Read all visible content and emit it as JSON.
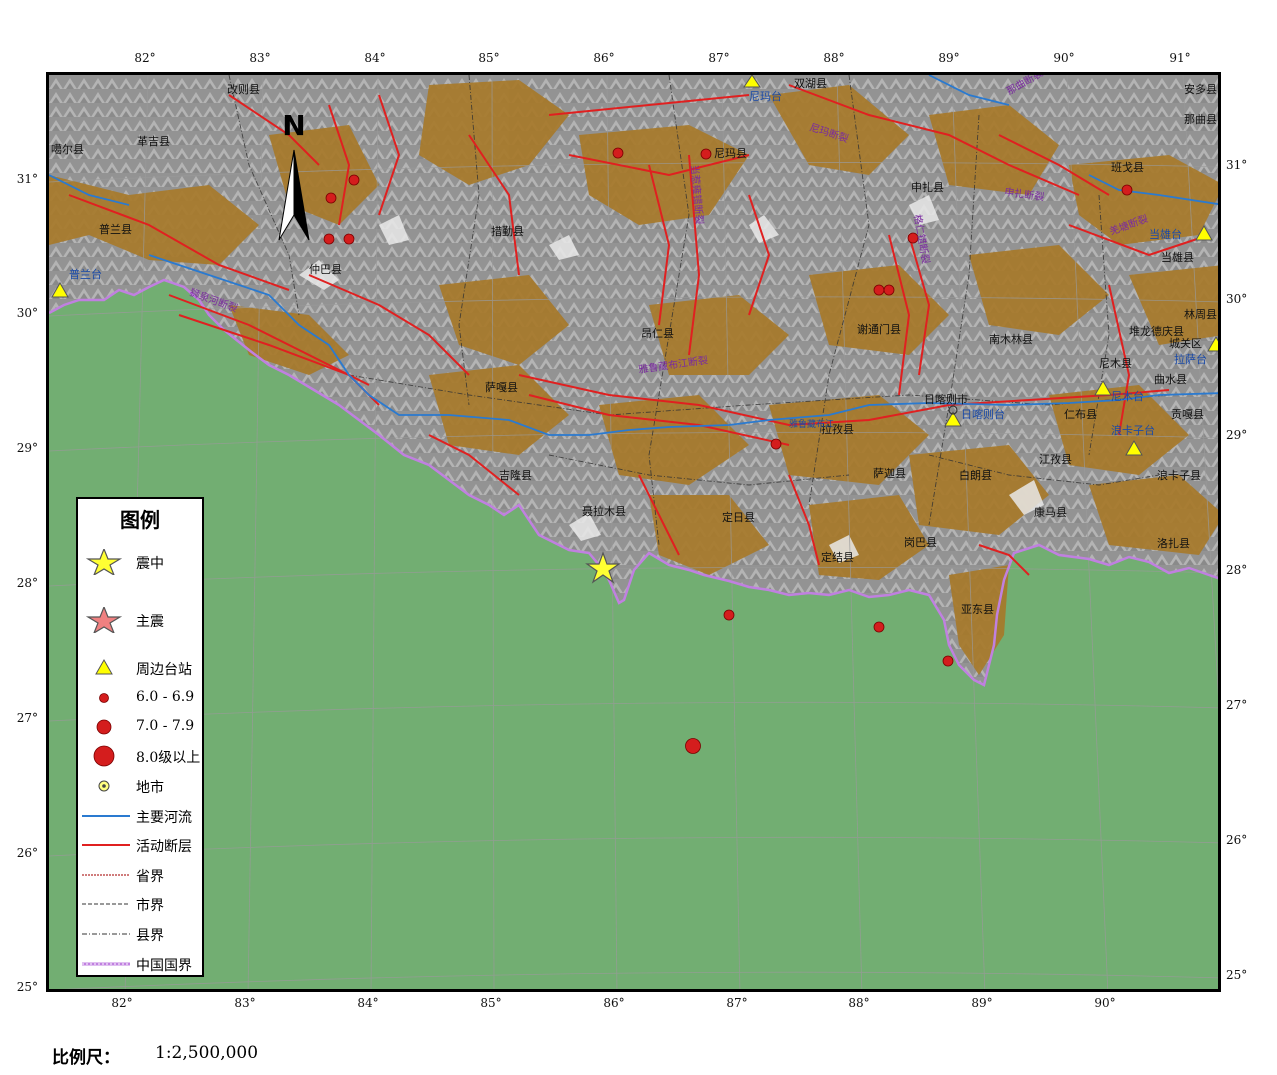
{
  "map": {
    "lon_ticks": [
      "82°",
      "83°",
      "84°",
      "85°",
      "86°",
      "87°",
      "88°",
      "89°",
      "90°",
      "91°"
    ],
    "lat_ticks": [
      "31°",
      "30°",
      "29°",
      "28°",
      "27°",
      "26°",
      "25°"
    ],
    "north_arrow": "N",
    "colors": {
      "ocean": "#72ae72",
      "plateau": "#a87a2a",
      "mountain": "#8e8e8e",
      "snow": "#e8e8e8",
      "fault": "#e02020",
      "river": "#2a7ad0",
      "border": "#c080e0",
      "quake": "#d41d1d",
      "station": "#ffff00",
      "epicenter": "#ffff33",
      "mainshock": "#f08080"
    }
  },
  "places": [
    "改则县",
    "革吉县",
    "噶尔县",
    "普兰县",
    "普兰台",
    "仲巴县",
    "措勤县",
    "尼玛县",
    "双湖县",
    "尼玛台",
    "申扎县",
    "班戈县",
    "安多县",
    "那曲县",
    "当雄台",
    "当雄县",
    "林周县",
    "堆龙德庆县",
    "城关区",
    "拉萨台",
    "曲水县",
    "贡嘎县",
    "尼木县",
    "尼木台",
    "南木林县",
    "谢通门县",
    "昂仁县",
    "萨嘎县",
    "吉隆县",
    "聂拉木县",
    "定日县",
    "拉孜县",
    "萨迦县",
    "日喀则市",
    "日喀则台",
    "仁布县",
    "江孜县",
    "白朗县",
    "浪卡子台",
    "浪卡子县",
    "康马县",
    "岗巴县",
    "定结县",
    "亚东县",
    "洛扎县"
  ],
  "faults": [
    "雅鲁藏布江断裂",
    "狮泉河断裂",
    "尼玛断裂",
    "当惹雍错断裂",
    "格仁错断裂",
    "那曲断裂",
    "羌塘断裂",
    "申扎断裂"
  ],
  "river_labels": [
    "雅鲁藏布江"
  ],
  "legend": {
    "title": "图例",
    "items": [
      {
        "label": "震中",
        "icon": "star-yellow-icon"
      },
      {
        "label": "主震",
        "icon": "star-pink-icon"
      },
      {
        "label": "周边台站",
        "icon": "triangle-yellow-icon"
      },
      {
        "label": "6.0 - 6.9",
        "icon": "dot-small-icon"
      },
      {
        "label": "7.0 - 7.9",
        "icon": "dot-medium-icon"
      },
      {
        "label": "8.0级以上",
        "icon": "dot-large-icon"
      },
      {
        "label": "地市",
        "icon": "city-circle-icon"
      },
      {
        "label": "主要河流",
        "icon": "river-line-icon"
      },
      {
        "label": "活动断层",
        "icon": "fault-line-icon"
      },
      {
        "label": "省界",
        "icon": "province-border-icon"
      },
      {
        "label": "市界",
        "icon": "city-border-icon"
      },
      {
        "label": "县界",
        "icon": "county-border-icon"
      },
      {
        "label": "中国国界",
        "icon": "national-border-icon"
      }
    ]
  },
  "scale": {
    "label": "比例尺：",
    "value": "1:2,500,000"
  }
}
